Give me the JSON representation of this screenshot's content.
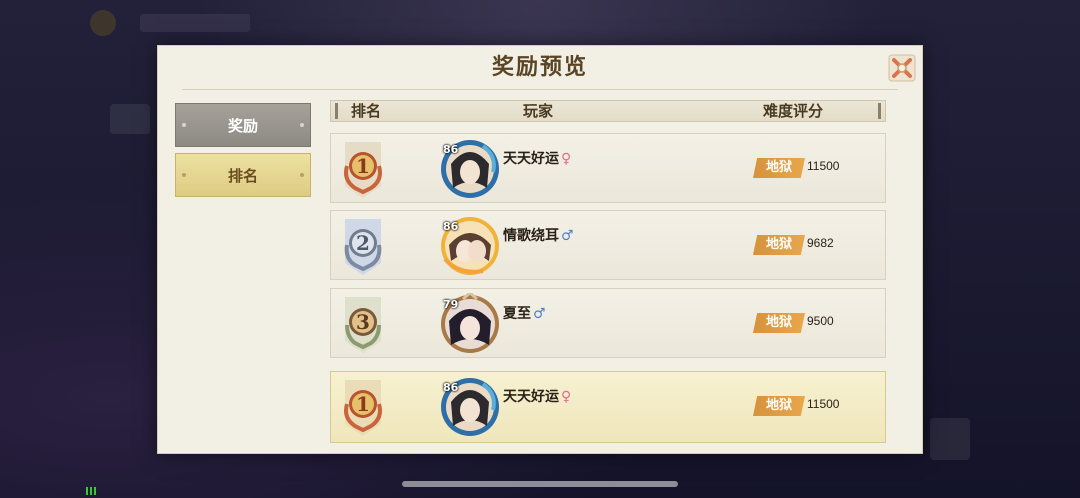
{
  "panel": {
    "title": "奖励预览"
  },
  "tabs": [
    {
      "label": "奖励",
      "active": false
    },
    {
      "label": "排名",
      "active": true
    }
  ],
  "table": {
    "headers": {
      "rank": "排名",
      "player": "玩家",
      "score": "难度评分"
    },
    "rows": [
      {
        "rank": "1",
        "level": "86",
        "name": "天天好运",
        "gender": "♀",
        "difficulty": "地狱",
        "score": "11500"
      },
      {
        "rank": "2",
        "level": "86",
        "name": "情歌绕耳",
        "gender": "♂",
        "difficulty": "地狱",
        "score": "9682"
      },
      {
        "rank": "3",
        "level": "79",
        "name": "夏至",
        "gender": "♂",
        "difficulty": "地狱",
        "score": "9500"
      },
      {
        "rank": "1",
        "level": "86",
        "name": "天天好运",
        "gender": "♀",
        "difficulty": "地狱",
        "score": "11500"
      }
    ]
  },
  "colors": {
    "gold": "#c9a24a",
    "silver": "#8a94a6",
    "bronze": "#b08a4a",
    "difficulty_tag": "#e19c46"
  },
  "icons": [
    "close-icon",
    "rank-1-badge-icon",
    "rank-2-badge-icon",
    "rank-3-badge-icon",
    "female-icon",
    "male-icon"
  ]
}
